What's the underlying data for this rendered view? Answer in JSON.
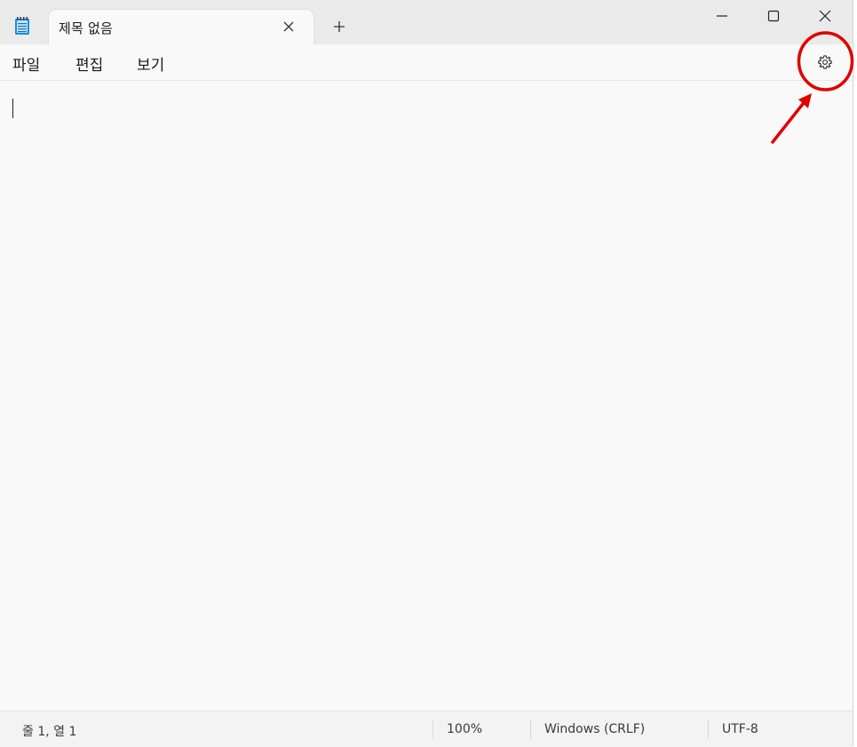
{
  "tab": {
    "title": "제목 없음"
  },
  "menu": {
    "file": "파일",
    "edit": "편집",
    "view": "보기"
  },
  "status": {
    "position": "줄 1, 열 1",
    "zoom": "100%",
    "line_ending": "Windows (CRLF)",
    "encoding": "UTF-8"
  },
  "icons": {
    "app": "notepad-icon",
    "tab_close": "close-icon",
    "new_tab": "plus-icon",
    "minimize": "minimize-icon",
    "maximize": "maximize-icon",
    "close": "close-icon",
    "settings": "gear-icon"
  },
  "colors": {
    "annotation": "#e00000",
    "titlebar": "#eaeaea",
    "editor_bg": "#f9f9f9"
  }
}
